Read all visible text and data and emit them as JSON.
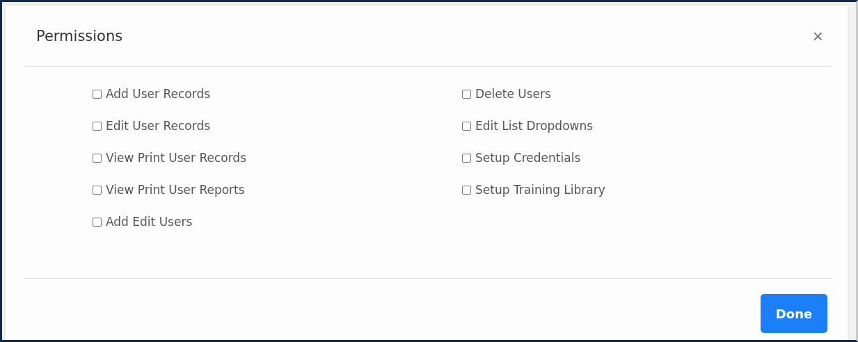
{
  "dialog": {
    "title": "Permissions",
    "close": "×"
  },
  "permission_columns": [
    [
      {
        "label": "Add User Records",
        "checked": false
      },
      {
        "label": "Edit User Records",
        "checked": false
      },
      {
        "label": "View Print User Records",
        "checked": false
      },
      {
        "label": "View Print User Reports",
        "checked": false
      },
      {
        "label": "Add Edit Users",
        "checked": false
      }
    ],
    [
      {
        "label": "Delete Users",
        "checked": false
      },
      {
        "label": "Edit List Dropdowns",
        "checked": false
      },
      {
        "label": "Setup Credentials",
        "checked": false
      },
      {
        "label": "Setup Training Library",
        "checked": false
      }
    ]
  ],
  "buttons": [
    "Done"
  ]
}
